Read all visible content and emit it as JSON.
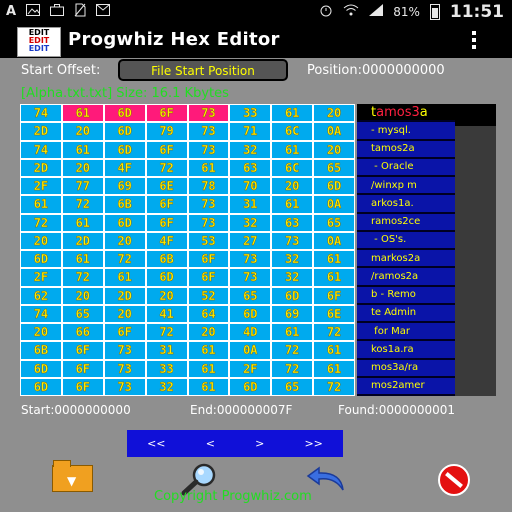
{
  "status_bar": {
    "left_icons": [
      "A",
      "x",
      "image-icon",
      "briefcase-icon",
      "sim-off-icon",
      "message-icon"
    ],
    "battery": "81%",
    "time": "11:51"
  },
  "app": {
    "title": "Progwhiz Hex Editor",
    "logo_lines": [
      "EDIT",
      "EDIT",
      "EDIT"
    ]
  },
  "offset": {
    "label": "Start Offset:",
    "button": "File Start Position",
    "position": "Position:0000000000"
  },
  "file_info": "[Alpha.txt.txt] Size: 16.1 Kbytes",
  "hex_rows": [
    [
      "74",
      "61",
      "6D",
      "6F",
      "73",
      "33",
      "61",
      "20"
    ],
    [
      "2D",
      "20",
      "6D",
      "79",
      "73",
      "71",
      "6C",
      "0A"
    ],
    [
      "74",
      "61",
      "6D",
      "6F",
      "73",
      "32",
      "61",
      "20"
    ],
    [
      "2D",
      "20",
      "4F",
      "72",
      "61",
      "63",
      "6C",
      "65"
    ],
    [
      "2F",
      "77",
      "69",
      "6E",
      "78",
      "70",
      "20",
      "6D"
    ],
    [
      "61",
      "72",
      "6B",
      "6F",
      "73",
      "31",
      "61",
      "0A"
    ],
    [
      "72",
      "61",
      "6D",
      "6F",
      "73",
      "32",
      "63",
      "65"
    ],
    [
      "20",
      "2D",
      "20",
      "4F",
      "53",
      "27",
      "73",
      "0A"
    ],
    [
      "6D",
      "61",
      "72",
      "6B",
      "6F",
      "73",
      "32",
      "61"
    ],
    [
      "2F",
      "72",
      "61",
      "6D",
      "6F",
      "73",
      "32",
      "61"
    ],
    [
      "62",
      "20",
      "2D",
      "20",
      "52",
      "65",
      "6D",
      "6F"
    ],
    [
      "74",
      "65",
      "20",
      "41",
      "64",
      "6D",
      "69",
      "6E"
    ],
    [
      "20",
      "66",
      "6F",
      "72",
      "20",
      "4D",
      "61",
      "72"
    ],
    [
      "6B",
      "6F",
      "73",
      "31",
      "61",
      "0A",
      "72",
      "61"
    ],
    [
      "6D",
      "6F",
      "73",
      "33",
      "61",
      "2F",
      "72",
      "61"
    ],
    [
      "6D",
      "6F",
      "73",
      "32",
      "61",
      "6D",
      "65",
      "72"
    ]
  ],
  "highlight": {
    "row": 0,
    "cols": [
      1,
      2,
      3,
      4
    ]
  },
  "text_rows": [
    {
      "plain": "t",
      "red": "amos3",
      "rest": "a"
    },
    {
      "plain": "- mysql.",
      "red": "",
      "rest": ""
    },
    {
      "plain": "tamos2a",
      "red": "",
      "rest": ""
    },
    {
      "plain": " - Oracle",
      "red": "",
      "rest": ""
    },
    {
      "plain": "/winxp m",
      "red": "",
      "rest": ""
    },
    {
      "plain": "arkos1a.",
      "red": "",
      "rest": ""
    },
    {
      "plain": "ramos2ce",
      "red": "",
      "rest": ""
    },
    {
      "plain": " - OS's.",
      "red": "",
      "rest": ""
    },
    {
      "plain": "markos2a",
      "red": "",
      "rest": ""
    },
    {
      "plain": "/ramos2a",
      "red": "",
      "rest": ""
    },
    {
      "plain": "b - Remo",
      "red": "",
      "rest": ""
    },
    {
      "plain": "te Admin",
      "red": "",
      "rest": ""
    },
    {
      "plain": " for Mar",
      "red": "",
      "rest": ""
    },
    {
      "plain": "kos1a.ra",
      "red": "",
      "rest": ""
    },
    {
      "plain": "mos3a/ra",
      "red": "",
      "rest": ""
    },
    {
      "plain": "mos2amer",
      "red": "",
      "rest": ""
    }
  ],
  "stats": {
    "start": "Start:0000000000",
    "end": "End:000000007F",
    "found": "Found:0000000001"
  },
  "nav": [
    "<<",
    "<",
    ">",
    ">>"
  ],
  "copyright": "Copyright Progwhiz.com",
  "colors": {
    "hex_cell": "#00aaee",
    "hex_highlight": "#ff1a7a",
    "hex_text": "#ffee00",
    "text_panel": "#0a14a8",
    "accent_green": "#22dd22"
  }
}
